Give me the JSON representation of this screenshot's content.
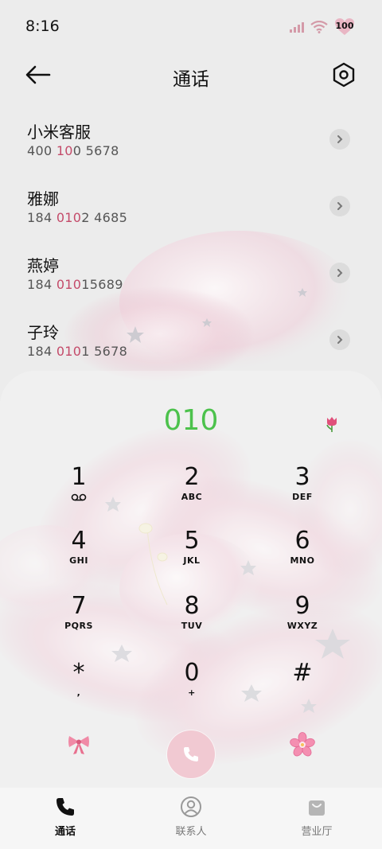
{
  "status": {
    "time": "8:16",
    "battery": "100"
  },
  "header": {
    "title": "通话"
  },
  "contacts": [
    {
      "name": "小米客服",
      "num_pre": "400 ",
      "num_hl": "10",
      "num_post": "0 5678"
    },
    {
      "name": "雅娜",
      "num_pre": "184 ",
      "num_hl": "010",
      "num_post": "2 4685"
    },
    {
      "name": "燕婷",
      "num_pre": "184 ",
      "num_hl": "010",
      "num_post": "15689"
    },
    {
      "name": "子玲",
      "num_pre": "184 ",
      "num_hl": "010",
      "num_post": "1 5678"
    }
  ],
  "dialer": {
    "input": "010",
    "keys": [
      {
        "digit": "1",
        "letters": ""
      },
      {
        "digit": "2",
        "letters": "ABC"
      },
      {
        "digit": "3",
        "letters": "DEF"
      },
      {
        "digit": "4",
        "letters": "GHI"
      },
      {
        "digit": "5",
        "letters": "JKL"
      },
      {
        "digit": "6",
        "letters": "MNO"
      },
      {
        "digit": "7",
        "letters": "PQRS"
      },
      {
        "digit": "8",
        "letters": "TUV"
      },
      {
        "digit": "9",
        "letters": "WXYZ"
      },
      {
        "digit": "*",
        "letters": ","
      },
      {
        "digit": "0",
        "letters": "+"
      },
      {
        "digit": "#",
        "letters": ""
      }
    ]
  },
  "nav": [
    {
      "label": "通话",
      "icon": "phone-icon",
      "active": true
    },
    {
      "label": "联系人",
      "icon": "contact-icon",
      "active": false
    },
    {
      "label": "营业厅",
      "icon": "bag-icon",
      "active": false
    }
  ],
  "colors": {
    "accent_green": "#4cc24c",
    "highlight_pink": "#c44b6a",
    "call_button": "#f1c9d2"
  }
}
